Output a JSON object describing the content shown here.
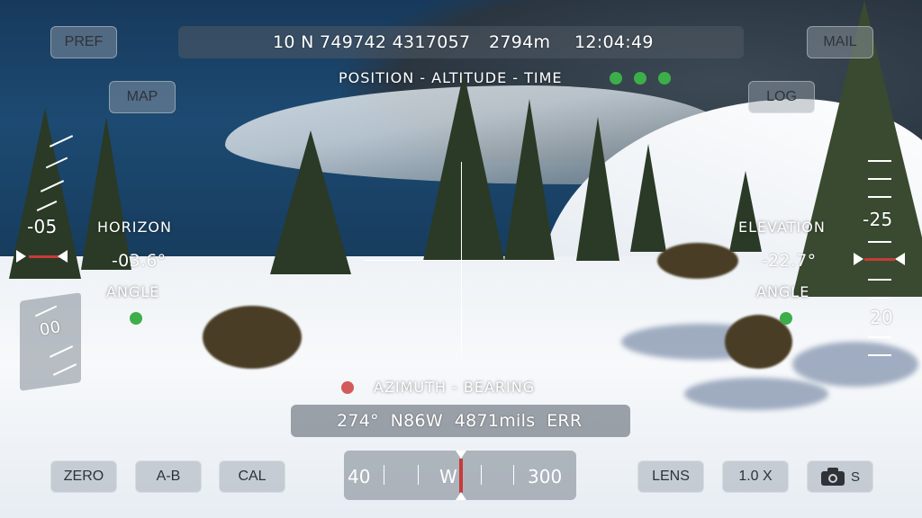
{
  "header": {
    "position": "10 N 749742 4317057",
    "altitude": "2794m",
    "time": "12:04:49",
    "caption": "POSITION - ALTITUDE - TIME"
  },
  "buttons": {
    "pref": "PREF",
    "map": "MAP",
    "mail": "MAIL",
    "log": "LOG",
    "zero": "ZERO",
    "ab": "A-B",
    "cal": "CAL",
    "lens": "LENS",
    "zoom": "1.0 X",
    "camera_suffix": "S"
  },
  "horizon": {
    "title": "HORIZON",
    "value": "-03.6°",
    "subtitle": "ANGLE",
    "scale_top": "-05",
    "scale_bottom": "00"
  },
  "elevation": {
    "title": "ELEVATION",
    "value": "-22.7°",
    "subtitle": "ANGLE",
    "scale_top": "-25",
    "scale_bottom": "20"
  },
  "azimuth": {
    "caption": "AZIMUTH - BEARING",
    "readout": "274°  N86W  4871mils  ERR"
  },
  "compass": {
    "left": "40",
    "center": "W",
    "right": "300"
  },
  "colors": {
    "status_ok": "#3cae4a",
    "status_error": "#d25a5a",
    "marker": "#c83a3a"
  }
}
